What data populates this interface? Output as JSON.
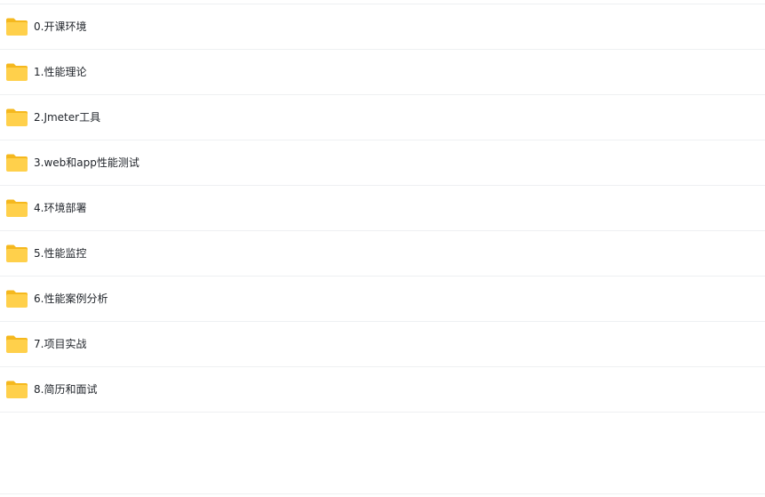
{
  "file_list": {
    "items": [
      {
        "label": "0.开课环境",
        "icon": "folder-icon"
      },
      {
        "label": "1.性能理论",
        "icon": "folder-icon"
      },
      {
        "label": "2.Jmeter工具",
        "icon": "folder-icon"
      },
      {
        "label": "3.web和app性能测试",
        "icon": "folder-icon"
      },
      {
        "label": "4.环境部署",
        "icon": "folder-icon"
      },
      {
        "label": "5.性能监控",
        "icon": "folder-icon"
      },
      {
        "label": "6.性能案例分析",
        "icon": "folder-icon"
      },
      {
        "label": "7.项目实战",
        "icon": "folder-icon"
      },
      {
        "label": "8.简历和面试",
        "icon": "folder-icon"
      }
    ]
  },
  "colors": {
    "folder_back": "#f5b81e",
    "folder_front": "#ffd04b",
    "divider": "#eef0f2",
    "text": "#1f2329"
  }
}
